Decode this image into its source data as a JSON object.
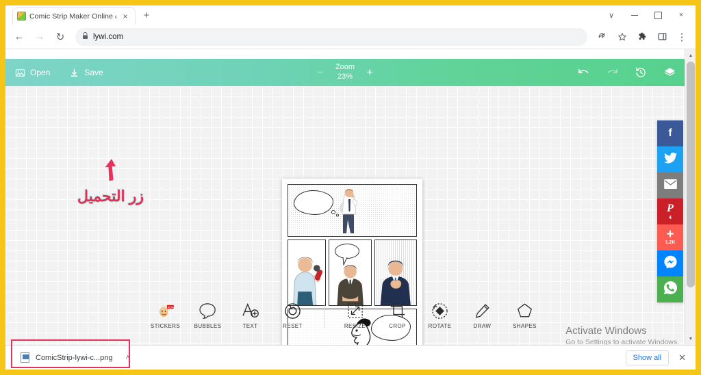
{
  "browser": {
    "tab": {
      "title": "Comic Strip Maker Online & Free",
      "favicon": "comic-favicon",
      "close_label": "×"
    },
    "new_tab_label": "+",
    "window_controls": {
      "more": "∨",
      "minimize": "minimize-icon",
      "maximize": "maximize-icon",
      "close": "×"
    },
    "nav": {
      "back": "←",
      "forward": "→",
      "reload": "↻",
      "lock": "🔒",
      "url": "lywi.com",
      "share": "share-icon",
      "bookmark": "☆",
      "extensions": "puzzle-icon",
      "sidepanel": "sidepanel-icon",
      "menu": "⋮"
    }
  },
  "editor": {
    "open_label": "Open",
    "save_label": "Save",
    "zoom_label": "Zoom",
    "zoom_value": "23%",
    "zoom_out": "−",
    "zoom_in": "+",
    "undo": "undo-icon",
    "redo": "redo-icon",
    "history": "history-icon",
    "layers": "layers-icon",
    "toolbar_gradient_start": "#7ed4c8",
    "toolbar_gradient_end": "#57d18d"
  },
  "annotation": {
    "text": "زر التحميل",
    "color": "#e03055",
    "arrow": "red-arrow-pointing-to-save"
  },
  "tools": {
    "left_group": [
      {
        "id": "stickers",
        "label": "STICKERS",
        "icon": "sticker-icon"
      },
      {
        "id": "bubbles",
        "label": "BUBBLES",
        "icon": "speech-bubble-icon"
      },
      {
        "id": "text",
        "label": "TEXT",
        "icon": "text-add-icon"
      },
      {
        "id": "reset",
        "label": "RESET",
        "icon": "reset-icon"
      }
    ],
    "right_group": [
      {
        "id": "resize",
        "label": "RESIZE",
        "icon": "resize-icon"
      },
      {
        "id": "crop",
        "label": "CROP",
        "icon": "crop-icon"
      },
      {
        "id": "rotate",
        "label": "ROTATE",
        "icon": "rotate-icon"
      },
      {
        "id": "draw",
        "label": "DRAW",
        "icon": "pencil-icon"
      },
      {
        "id": "shapes",
        "label": "SHAPES",
        "icon": "pentagon-icon"
      }
    ]
  },
  "social": [
    {
      "id": "facebook",
      "glyph": "f",
      "color": "#3b5998",
      "count": ""
    },
    {
      "id": "twitter",
      "glyph": "🐦",
      "color": "#1da1f2",
      "count": ""
    },
    {
      "id": "email",
      "glyph": "✉",
      "color": "#7d7d7d",
      "count": ""
    },
    {
      "id": "pinterest",
      "glyph": "P",
      "color": "#cb2027",
      "count": "4"
    },
    {
      "id": "share-more",
      "glyph": "+",
      "color": "#fb5b50",
      "count": "1.2K"
    },
    {
      "id": "messenger",
      "glyph": "⚡",
      "color": "#0084ff",
      "count": ""
    },
    {
      "id": "whatsapp",
      "glyph": "✆",
      "color": "#4caf50",
      "count": ""
    }
  ],
  "comic": {
    "panels": [
      {
        "id": "panel-1",
        "description": "man thinking with thought cloud"
      },
      {
        "id": "panel-2",
        "description": "woman holding microphone"
      },
      {
        "id": "panel-3",
        "description": "man in suit speaking with bubble"
      },
      {
        "id": "panel-4",
        "description": "man clapping hands"
      },
      {
        "id": "panel-5",
        "description": "cartoon man with thought cloud"
      }
    ]
  },
  "activate_windows": {
    "title": "Activate Windows",
    "subtitle": "Go to Settings to activate Windows."
  },
  "downloads": {
    "filename": "ComicStrip-lywi-c...png",
    "expand": "˄",
    "show_all": "Show all",
    "close": "✕",
    "highlight_color": "#e8325c"
  }
}
